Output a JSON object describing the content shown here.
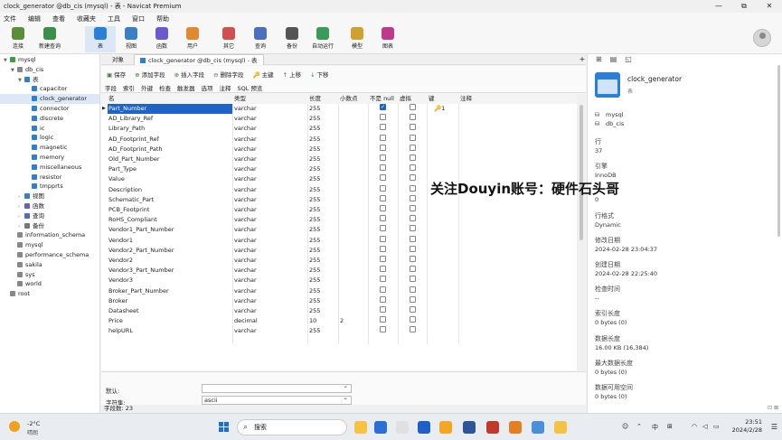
{
  "window": {
    "title": "clock_generator @db_cis (mysql) - 表 - Navicat Premium",
    "controls": [
      "—",
      "⧉",
      "✕"
    ]
  },
  "menu": [
    "文件",
    "编辑",
    "查看",
    "收藏夹",
    "工具",
    "窗口",
    "帮助"
  ],
  "toolbar": [
    {
      "label": "连接",
      "color": "#5a8f3a"
    },
    {
      "label": "新建查询",
      "color": "#3a8f4a"
    },
    {
      "label": "表",
      "color": "#2a7fd6",
      "active": true
    },
    {
      "label": "视图",
      "color": "#3a7fc6"
    },
    {
      "label": "函数",
      "color": "#6a5acd"
    },
    {
      "label": "用户",
      "color": "#e08a30"
    },
    {
      "label": "其它",
      "color": "#d05050"
    },
    {
      "label": "查询",
      "color": "#4a6fc0"
    },
    {
      "label": "备份",
      "color": "#555555"
    },
    {
      "label": "自动运行",
      "color": "#3a9a5a"
    },
    {
      "label": "模型",
      "color": "#d0a030"
    },
    {
      "label": "图表",
      "color": "#c03a8a"
    }
  ],
  "sidebar": [
    {
      "label": "mysql",
      "level": 0,
      "arrow": "▼",
      "color": "#3aa03a"
    },
    {
      "label": "db_cis",
      "level": 1,
      "arrow": "▼",
      "color": "#888888"
    },
    {
      "label": "表",
      "level": 2,
      "arrow": "▼",
      "color": "#2a7fd6"
    },
    {
      "label": "capacitor",
      "level": 3,
      "arrow": "",
      "color": "#2a7fd6"
    },
    {
      "label": "clock_generator",
      "level": 3,
      "arrow": "",
      "color": "#2a7fd6",
      "selected": true
    },
    {
      "label": "connector",
      "level": 3,
      "arrow": "",
      "color": "#2a7fd6"
    },
    {
      "label": "discrete",
      "level": 3,
      "arrow": "",
      "color": "#2a7fd6"
    },
    {
      "label": "ic",
      "level": 3,
      "arrow": "",
      "color": "#2a7fd6"
    },
    {
      "label": "logic",
      "level": 3,
      "arrow": "",
      "color": "#2a7fd6"
    },
    {
      "label": "magnetic",
      "level": 3,
      "arrow": "",
      "color": "#2a7fd6"
    },
    {
      "label": "memory",
      "level": 3,
      "arrow": "",
      "color": "#2a7fd6"
    },
    {
      "label": "miscellaneous",
      "level": 3,
      "arrow": "",
      "color": "#2a7fd6"
    },
    {
      "label": "resistor",
      "level": 3,
      "arrow": "",
      "color": "#2a7fd6"
    },
    {
      "label": "tmpprts",
      "level": 3,
      "arrow": "",
      "color": "#2a7fd6"
    },
    {
      "label": "视图",
      "level": 2,
      "arrow": "›",
      "color": "#3a7fc6"
    },
    {
      "label": "函数",
      "level": 2,
      "arrow": "›",
      "color": "#6a5acd"
    },
    {
      "label": "查询",
      "level": 2,
      "arrow": "›",
      "color": "#4a6fc0"
    },
    {
      "label": "备份",
      "level": 2,
      "arrow": "›",
      "color": "#777777"
    },
    {
      "label": "information_schema",
      "level": 1,
      "arrow": "",
      "color": "#888888"
    },
    {
      "label": "mysql",
      "level": 1,
      "arrow": "",
      "color": "#888888"
    },
    {
      "label": "performance_schema",
      "level": 1,
      "arrow": "",
      "color": "#888888"
    },
    {
      "label": "sakila",
      "level": 1,
      "arrow": "",
      "color": "#888888"
    },
    {
      "label": "sys",
      "level": 1,
      "arrow": "",
      "color": "#888888"
    },
    {
      "label": "world",
      "level": 1,
      "arrow": "",
      "color": "#888888"
    },
    {
      "label": "root",
      "level": 0,
      "arrow": "",
      "color": "#888888"
    }
  ],
  "tabs": {
    "objects": "对象",
    "active": "clock_generator @db_cis (mysql) - 表",
    "plus": "+"
  },
  "actions": [
    {
      "icon": "▣",
      "label": "保存"
    },
    {
      "icon": "⊕",
      "label": "添加字段"
    },
    {
      "icon": "⊕",
      "label": "插入字段"
    },
    {
      "icon": "⊖",
      "label": "删除字段"
    },
    {
      "icon": "🔑",
      "label": "主键"
    },
    {
      "icon": "↑",
      "label": "上移"
    },
    {
      "icon": "↓",
      "label": "下移"
    }
  ],
  "subtabs": [
    "字段",
    "索引",
    "外键",
    "检查",
    "触发器",
    "选项",
    "注释",
    "SQL 预览"
  ],
  "grid": {
    "headers": {
      "name": "名",
      "type": "类型",
      "length": "长度",
      "decimals": "小数点",
      "notnull": "不是 null",
      "virtual": "虚拟",
      "key": "键",
      "comment": "注释"
    },
    "key_value": "🔑1",
    "rows": [
      {
        "name": "Part_Number",
        "type": "varchar",
        "length": "255",
        "decimals": "",
        "notnull": true,
        "key": true
      },
      {
        "name": "AD_Library_Ref",
        "type": "varchar",
        "length": "255",
        "decimals": "",
        "notnull": false
      },
      {
        "name": "Library_Path",
        "type": "varchar",
        "length": "255",
        "decimals": "",
        "notnull": false
      },
      {
        "name": "AD_Footprint_Ref",
        "type": "varchar",
        "length": "255",
        "decimals": "",
        "notnull": false
      },
      {
        "name": "AD_Footprint_Path",
        "type": "varchar",
        "length": "255",
        "decimals": "",
        "notnull": false
      },
      {
        "name": "Old_Part_Number",
        "type": "varchar",
        "length": "255",
        "decimals": "",
        "notnull": false
      },
      {
        "name": "Part_Type",
        "type": "varchar",
        "length": "255",
        "decimals": "",
        "notnull": false
      },
      {
        "name": "Value",
        "type": "varchar",
        "length": "255",
        "decimals": "",
        "notnull": false
      },
      {
        "name": "Description",
        "type": "varchar",
        "length": "255",
        "decimals": "",
        "notnull": false
      },
      {
        "name": "Schematic_Part",
        "type": "varchar",
        "length": "255",
        "decimals": "",
        "notnull": false
      },
      {
        "name": "PCB_Footprint",
        "type": "varchar",
        "length": "255",
        "decimals": "",
        "notnull": false
      },
      {
        "name": "RoHS_Compliant",
        "type": "varchar",
        "length": "255",
        "decimals": "",
        "notnull": false
      },
      {
        "name": "Vendor1_Part_Number",
        "type": "varchar",
        "length": "255",
        "decimals": "",
        "notnull": false
      },
      {
        "name": "Vendor1",
        "type": "varchar",
        "length": "255",
        "decimals": "",
        "notnull": false
      },
      {
        "name": "Vendor2_Part_Number",
        "type": "varchar",
        "length": "255",
        "decimals": "",
        "notnull": false
      },
      {
        "name": "Vendor2",
        "type": "varchar",
        "length": "255",
        "decimals": "",
        "notnull": false
      },
      {
        "name": "Vendor3_Part_Number",
        "type": "varchar",
        "length": "255",
        "decimals": "",
        "notnull": false
      },
      {
        "name": "Vendor3",
        "type": "varchar",
        "length": "255",
        "decimals": "",
        "notnull": false
      },
      {
        "name": "Broker_Part_Number",
        "type": "varchar",
        "length": "255",
        "decimals": "",
        "notnull": false
      },
      {
        "name": "Broker",
        "type": "varchar",
        "length": "255",
        "decimals": "",
        "notnull": false
      },
      {
        "name": "Datasheet",
        "type": "varchar",
        "length": "255",
        "decimals": "",
        "notnull": false
      },
      {
        "name": "Price",
        "type": "decimal",
        "length": "10",
        "decimals": "2",
        "notnull": false
      },
      {
        "name": "helpURL",
        "type": "varchar",
        "length": "255",
        "decimals": "",
        "notnull": false
      }
    ]
  },
  "props": {
    "default_label": "默认:",
    "default_value": "",
    "charset_label": "字符集:",
    "charset_value": "ascii"
  },
  "status": "字段数: 23",
  "right_panel": {
    "title": "clock_generator",
    "subtitle": "表",
    "db1": "mysql",
    "db2": "db_cis",
    "fields": [
      {
        "label": "行",
        "value": "37"
      },
      {
        "label": "引擎",
        "value": "InnoDB"
      },
      {
        "label": "",
        "value": "0"
      },
      {
        "label": "行格式",
        "value": "Dynamic"
      },
      {
        "label": "修改日期",
        "value": "2024-02-28 23:04:37"
      },
      {
        "label": "创建日期",
        "value": "2024-02-28 22:25:40"
      },
      {
        "label": "检查时间",
        "value": "--"
      },
      {
        "label": "索引长度",
        "value": "0 bytes (0)"
      },
      {
        "label": "数据长度",
        "value": "16.00 KB (16,384)"
      },
      {
        "label": "最大数据长度",
        "value": "0 bytes (0)"
      },
      {
        "label": "数据可用空间",
        "value": "0 bytes (0)"
      }
    ]
  },
  "watermark": "关注Douyin账号：硬件石头哥",
  "taskbar": {
    "temp": "-2°C",
    "weather": "晴朗",
    "search": "搜索",
    "ime": "中",
    "time": "23:51",
    "date": "2024/2/28",
    "apps": [
      "#f5c242",
      "#2a6fd6",
      "#e0e0e0",
      "#1e5fc8",
      "#f5a623",
      "#2b579a",
      "#c0392b",
      "#e67e22",
      "#4a90d9",
      "#f5c242"
    ]
  }
}
